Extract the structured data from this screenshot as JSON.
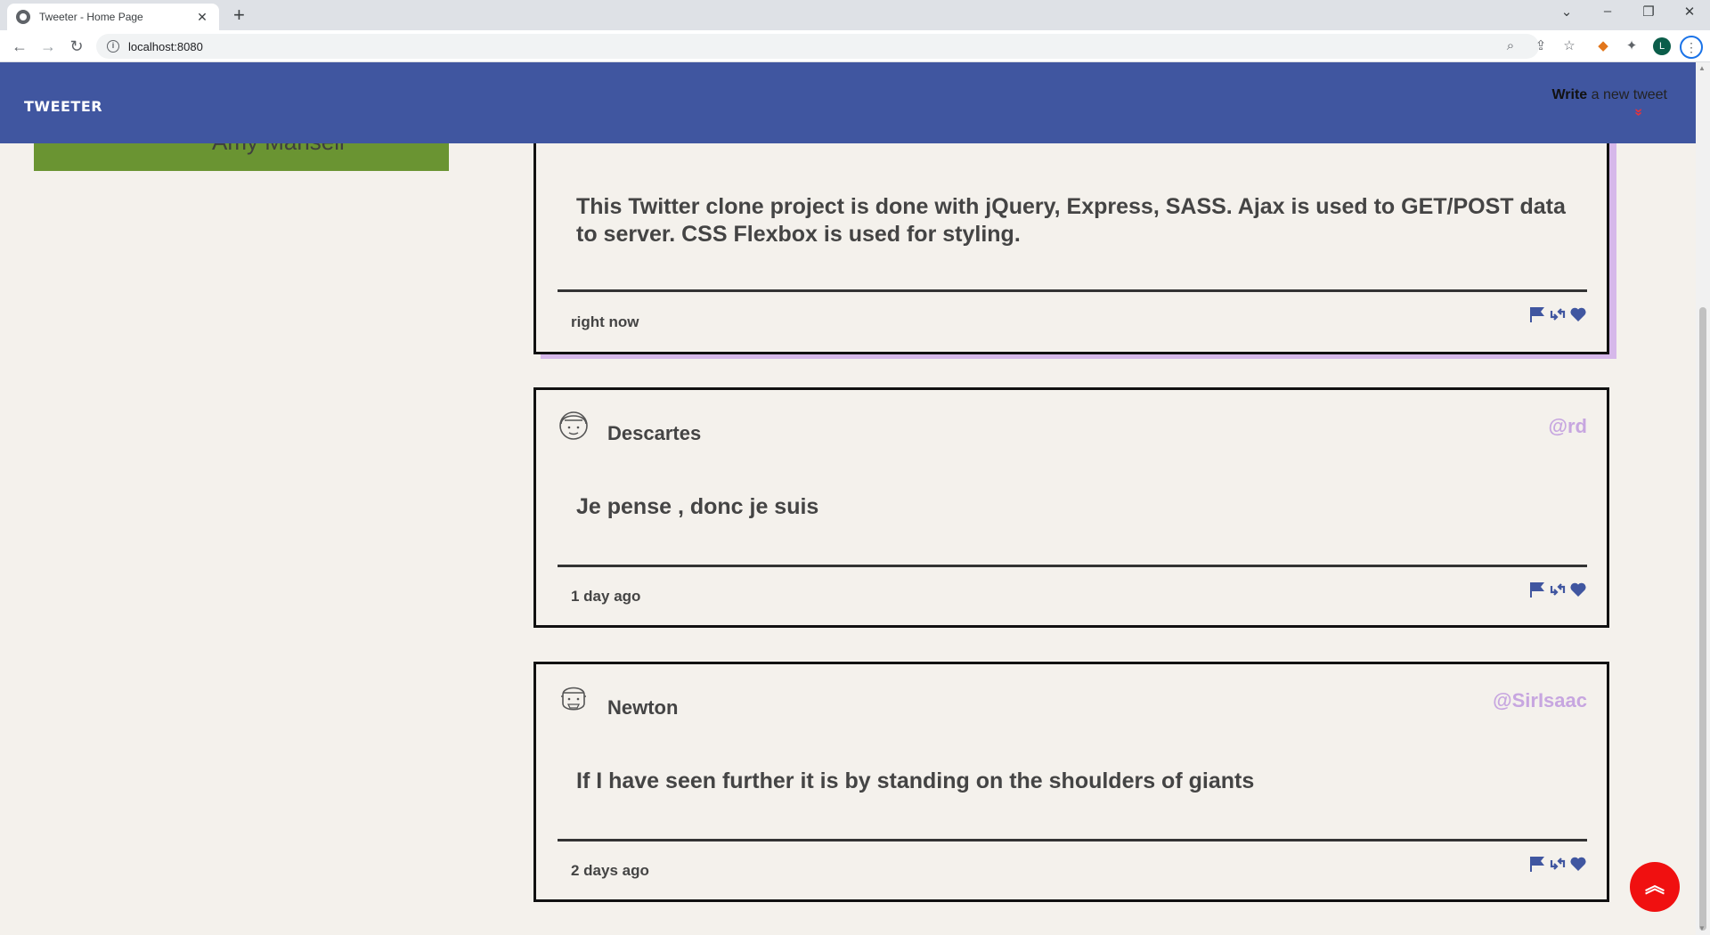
{
  "browser": {
    "tab_title": "Tweeter - Home Page",
    "tab_close": "✕",
    "new_tab": "+",
    "url": "localhost:8080",
    "profile_initial": "L"
  },
  "nav": {
    "brand": "TWEETER",
    "write_bold": "Write",
    "write_rest": " a new tweet",
    "write_chevron": "»"
  },
  "profile": {
    "name": "Amy Mansell"
  },
  "tweets": [
    {
      "name": "",
      "handle": "",
      "text": "This Twitter clone project is done with jQuery, Express, SASS. Ajax is used to GET/POST data to server. CSS Flexbox is used for styling.",
      "time": "right now"
    },
    {
      "name": "Descartes",
      "handle": "@rd",
      "text": "Je pense , donc je suis",
      "time": "1 day ago"
    },
    {
      "name": "Newton",
      "handle": "@SirIsaac",
      "text": "If I have seen further it is by standing on the shoulders of giants",
      "time": "2 days ago"
    }
  ],
  "colors": {
    "nav": "#4056a0",
    "background": "#f4f1ec",
    "handle": "#c7a6e0",
    "action_icons": "#4056a0",
    "scroll_button": "#f01010"
  }
}
